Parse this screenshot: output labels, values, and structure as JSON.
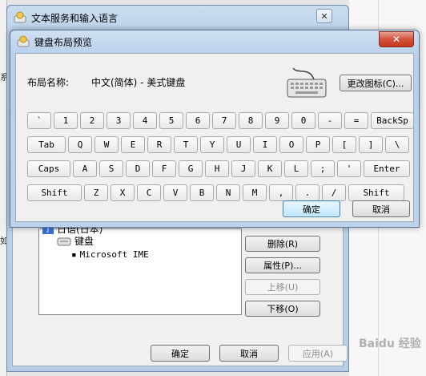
{
  "back_window": {
    "title": "文本服务和输入语言",
    "close_glyph": "✕",
    "tree": {
      "language": "日语(日本)",
      "category": "键盘",
      "item": "Microsoft IME"
    },
    "buttons": {
      "remove": "删除(R)",
      "properties": "属性(P)...",
      "move_up": "上移(U)",
      "move_down": "下移(O)"
    },
    "footer": {
      "ok": "确定",
      "cancel": "取消",
      "apply": "应用(A)"
    }
  },
  "dialog": {
    "title": "键盘布局预览",
    "close_glyph": "✕",
    "layout_label": "布局名称:",
    "layout_value": "中文(简体) - 美式键盘",
    "change_icon_button": "更改图标(C)...",
    "ok": "确定",
    "cancel": "取消",
    "keyboard_rows": [
      [
        "`",
        "1",
        "2",
        "3",
        "4",
        "5",
        "6",
        "7",
        "8",
        "9",
        "0",
        "-",
        "=",
        "BackSp"
      ],
      [
        "Tab",
        "Q",
        "W",
        "E",
        "R",
        "T",
        "Y",
        "U",
        "I",
        "O",
        "P",
        "[",
        "]",
        "\\"
      ],
      [
        "Caps",
        "A",
        "S",
        "D",
        "F",
        "G",
        "H",
        "J",
        "K",
        "L",
        ";",
        "'",
        "Enter"
      ],
      [
        "Shift",
        "Z",
        "X",
        "C",
        "V",
        "B",
        "N",
        "M",
        ",",
        ".",
        "/",
        "Shift"
      ]
    ]
  },
  "edge_glyphs": {
    "top": "系",
    "bottom": "如"
  },
  "watermark": "Baidu 经验",
  "colors": {
    "title_bar": "#bcd2ea",
    "close_red": "#c2381f",
    "default_button": "#bee6fd"
  }
}
